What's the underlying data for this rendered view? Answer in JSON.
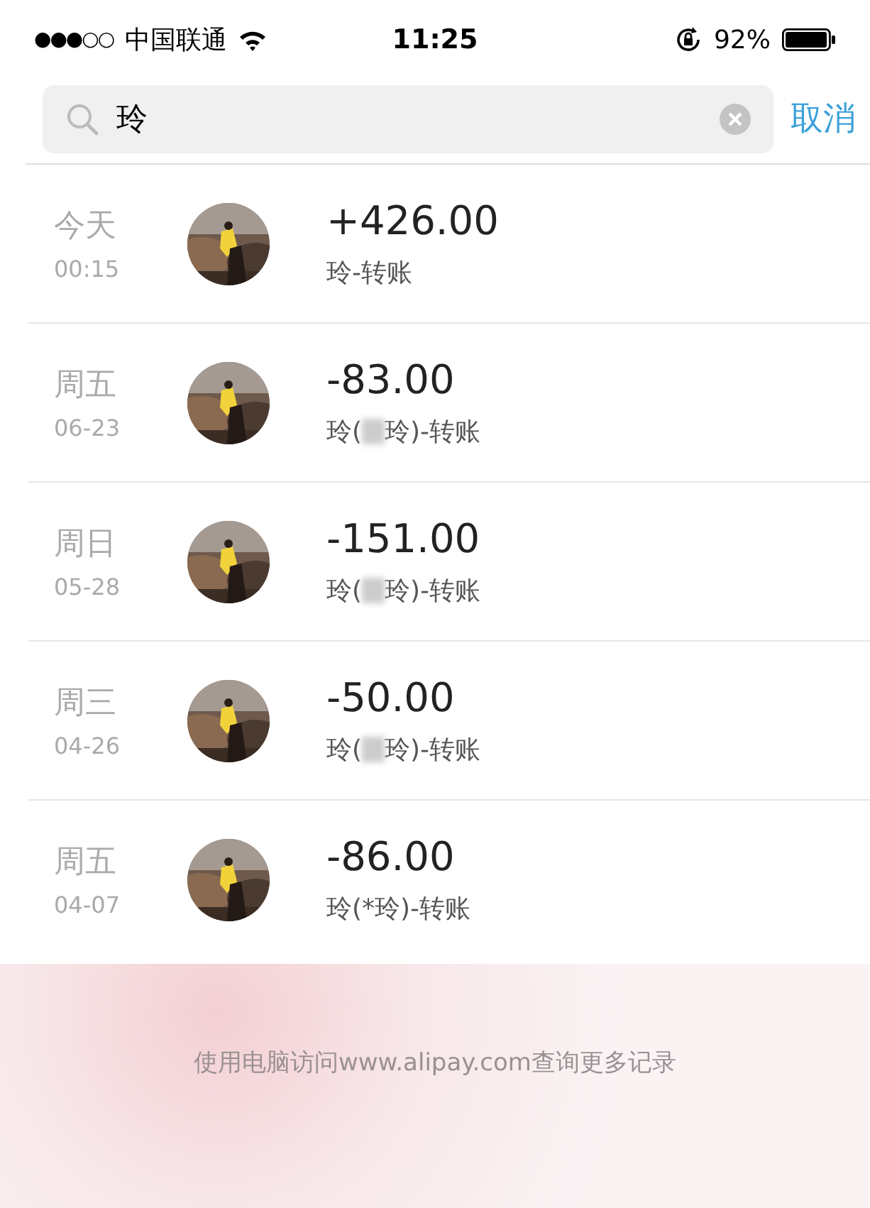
{
  "status_bar": {
    "signal": "●●●○○",
    "carrier": "中国联通",
    "time": "11:25",
    "battery": "92%"
  },
  "search": {
    "value": "玲",
    "cancel": "取消"
  },
  "records": [
    {
      "day": "今天",
      "time": "00:15",
      "amount": "+426.00",
      "memo": "玲-转账",
      "masked": false
    },
    {
      "day": "周五",
      "time": "06-23",
      "amount": "-83.00",
      "memo": "玲(",
      "memo_end": "玲)-转账",
      "masked": true
    },
    {
      "day": "周日",
      "time": "05-28",
      "amount": "-151.00",
      "memo": "玲(",
      "memo_end": "玲)-转账",
      "masked": true
    },
    {
      "day": "周三",
      "time": "04-26",
      "amount": "-50.00",
      "memo": "玲(",
      "memo_end": "玲)-转账",
      "masked": true
    },
    {
      "day": "周五",
      "time": "04-07",
      "amount": "-86.00",
      "memo": "玲(*玲)-转账",
      "masked": false
    }
  ],
  "footer": "使用电脑访问www.alipay.com查询更多记录"
}
